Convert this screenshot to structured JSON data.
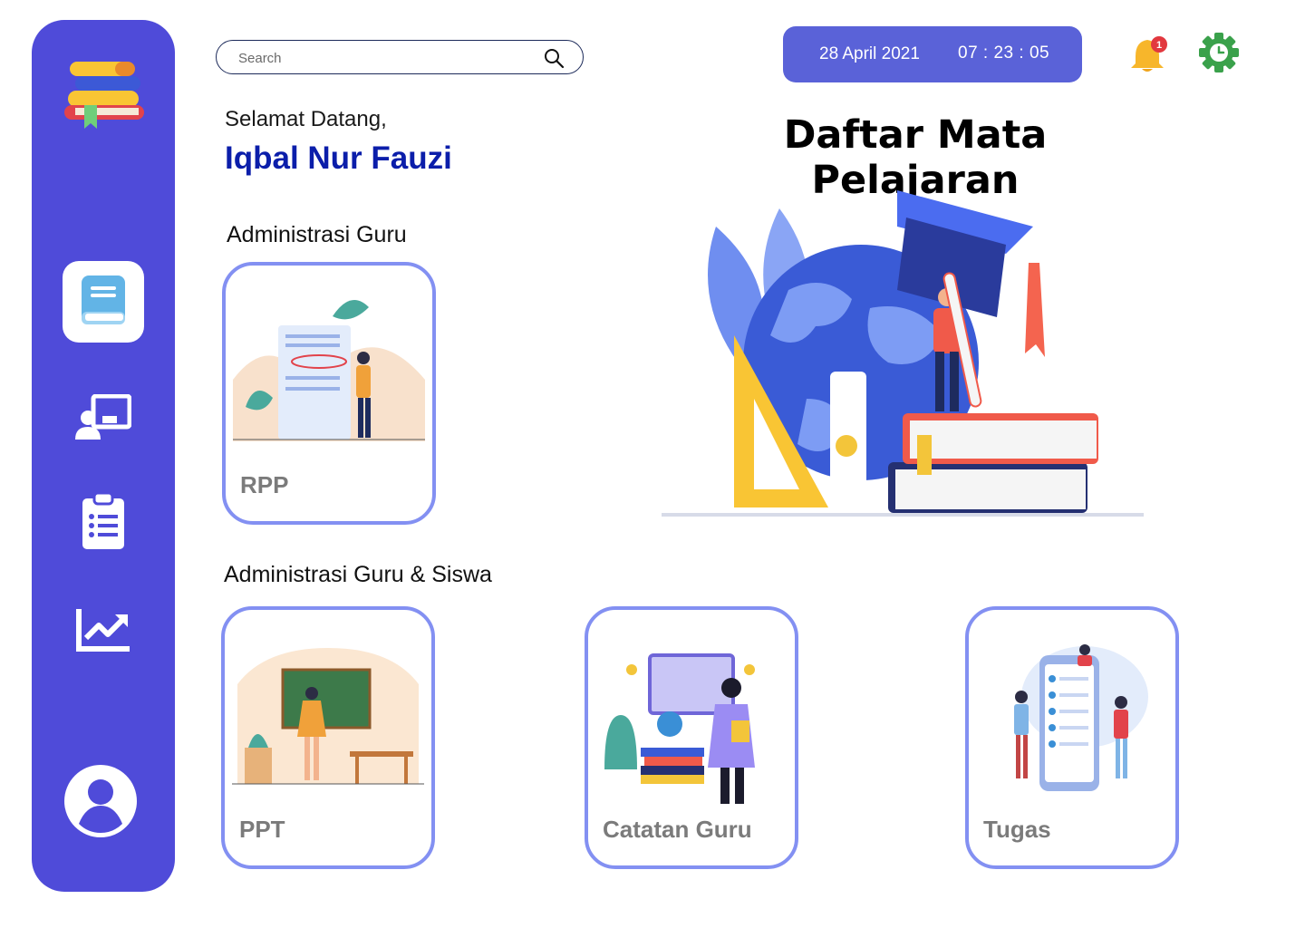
{
  "search": {
    "placeholder": "Search"
  },
  "header": {
    "date": "28 April 2021",
    "time": "07 : 23 : 05",
    "notification_count": "1"
  },
  "greeting": {
    "welcome": "Selamat Datang,",
    "user_name": "Iqbal Nur Fauzi"
  },
  "page_title": "Daftar Mata Pelajaran",
  "sections": {
    "teacher_admin": "Administrasi Guru",
    "teacher_student_admin": "Administrasi Guru & Siswa"
  },
  "cards": [
    {
      "label": "RPP"
    },
    {
      "label": "PPT"
    },
    {
      "label": "Catatan Guru"
    },
    {
      "label": "Tugas"
    }
  ],
  "colors": {
    "sidebar": "#4f4bd9",
    "card_border": "#8390f2",
    "datetime_bg": "#5a62d8",
    "username": "#0b1eaa",
    "bell": "#f7b62b",
    "gear": "#3aa14b"
  },
  "icons": {
    "logo": "books-logo-icon",
    "nav": [
      "book-icon",
      "presentation-icon",
      "clipboard-list-icon",
      "chart-line-icon",
      "user-profile-icon"
    ],
    "search": "search-icon",
    "notification": "bell-icon",
    "settings": "gear-clock-icon"
  }
}
